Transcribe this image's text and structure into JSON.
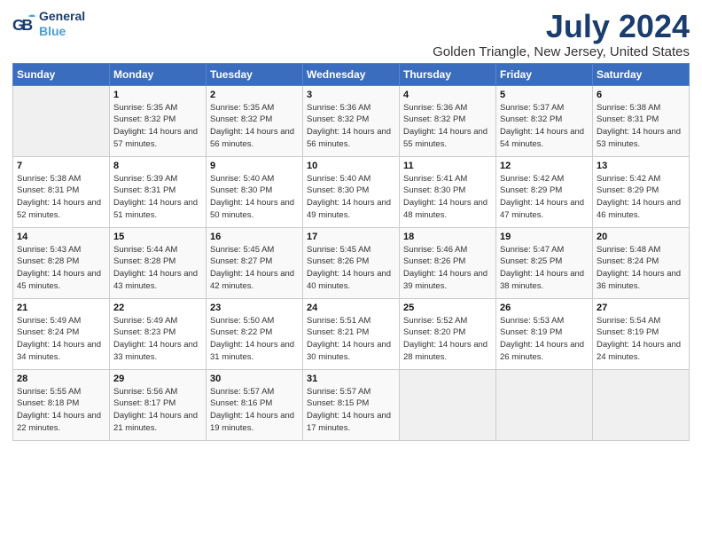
{
  "header": {
    "logo_general": "General",
    "logo_blue": "Blue",
    "month_title": "July 2024",
    "location": "Golden Triangle, New Jersey, United States"
  },
  "weekdays": [
    "Sunday",
    "Monday",
    "Tuesday",
    "Wednesday",
    "Thursday",
    "Friday",
    "Saturday"
  ],
  "weeks": [
    [
      {
        "day": "",
        "empty": true
      },
      {
        "day": "1",
        "sunrise": "5:35 AM",
        "sunset": "8:32 PM",
        "daylight": "14 hours and 57 minutes."
      },
      {
        "day": "2",
        "sunrise": "5:35 AM",
        "sunset": "8:32 PM",
        "daylight": "14 hours and 56 minutes."
      },
      {
        "day": "3",
        "sunrise": "5:36 AM",
        "sunset": "8:32 PM",
        "daylight": "14 hours and 56 minutes."
      },
      {
        "day": "4",
        "sunrise": "5:36 AM",
        "sunset": "8:32 PM",
        "daylight": "14 hours and 55 minutes."
      },
      {
        "day": "5",
        "sunrise": "5:37 AM",
        "sunset": "8:32 PM",
        "daylight": "14 hours and 54 minutes."
      },
      {
        "day": "6",
        "sunrise": "5:38 AM",
        "sunset": "8:31 PM",
        "daylight": "14 hours and 53 minutes."
      }
    ],
    [
      {
        "day": "7",
        "sunrise": "5:38 AM",
        "sunset": "8:31 PM",
        "daylight": "14 hours and 52 minutes."
      },
      {
        "day": "8",
        "sunrise": "5:39 AM",
        "sunset": "8:31 PM",
        "daylight": "14 hours and 51 minutes."
      },
      {
        "day": "9",
        "sunrise": "5:40 AM",
        "sunset": "8:30 PM",
        "daylight": "14 hours and 50 minutes."
      },
      {
        "day": "10",
        "sunrise": "5:40 AM",
        "sunset": "8:30 PM",
        "daylight": "14 hours and 49 minutes."
      },
      {
        "day": "11",
        "sunrise": "5:41 AM",
        "sunset": "8:30 PM",
        "daylight": "14 hours and 48 minutes."
      },
      {
        "day": "12",
        "sunrise": "5:42 AM",
        "sunset": "8:29 PM",
        "daylight": "14 hours and 47 minutes."
      },
      {
        "day": "13",
        "sunrise": "5:42 AM",
        "sunset": "8:29 PM",
        "daylight": "14 hours and 46 minutes."
      }
    ],
    [
      {
        "day": "14",
        "sunrise": "5:43 AM",
        "sunset": "8:28 PM",
        "daylight": "14 hours and 45 minutes."
      },
      {
        "day": "15",
        "sunrise": "5:44 AM",
        "sunset": "8:28 PM",
        "daylight": "14 hours and 43 minutes."
      },
      {
        "day": "16",
        "sunrise": "5:45 AM",
        "sunset": "8:27 PM",
        "daylight": "14 hours and 42 minutes."
      },
      {
        "day": "17",
        "sunrise": "5:45 AM",
        "sunset": "8:26 PM",
        "daylight": "14 hours and 40 minutes."
      },
      {
        "day": "18",
        "sunrise": "5:46 AM",
        "sunset": "8:26 PM",
        "daylight": "14 hours and 39 minutes."
      },
      {
        "day": "19",
        "sunrise": "5:47 AM",
        "sunset": "8:25 PM",
        "daylight": "14 hours and 38 minutes."
      },
      {
        "day": "20",
        "sunrise": "5:48 AM",
        "sunset": "8:24 PM",
        "daylight": "14 hours and 36 minutes."
      }
    ],
    [
      {
        "day": "21",
        "sunrise": "5:49 AM",
        "sunset": "8:24 PM",
        "daylight": "14 hours and 34 minutes."
      },
      {
        "day": "22",
        "sunrise": "5:49 AM",
        "sunset": "8:23 PM",
        "daylight": "14 hours and 33 minutes."
      },
      {
        "day": "23",
        "sunrise": "5:50 AM",
        "sunset": "8:22 PM",
        "daylight": "14 hours and 31 minutes."
      },
      {
        "day": "24",
        "sunrise": "5:51 AM",
        "sunset": "8:21 PM",
        "daylight": "14 hours and 30 minutes."
      },
      {
        "day": "25",
        "sunrise": "5:52 AM",
        "sunset": "8:20 PM",
        "daylight": "14 hours and 28 minutes."
      },
      {
        "day": "26",
        "sunrise": "5:53 AM",
        "sunset": "8:19 PM",
        "daylight": "14 hours and 26 minutes."
      },
      {
        "day": "27",
        "sunrise": "5:54 AM",
        "sunset": "8:19 PM",
        "daylight": "14 hours and 24 minutes."
      }
    ],
    [
      {
        "day": "28",
        "sunrise": "5:55 AM",
        "sunset": "8:18 PM",
        "daylight": "14 hours and 22 minutes."
      },
      {
        "day": "29",
        "sunrise": "5:56 AM",
        "sunset": "8:17 PM",
        "daylight": "14 hours and 21 minutes."
      },
      {
        "day": "30",
        "sunrise": "5:57 AM",
        "sunset": "8:16 PM",
        "daylight": "14 hours and 19 minutes."
      },
      {
        "day": "31",
        "sunrise": "5:57 AM",
        "sunset": "8:15 PM",
        "daylight": "14 hours and 17 minutes."
      },
      {
        "day": "",
        "empty": true
      },
      {
        "day": "",
        "empty": true
      },
      {
        "day": "",
        "empty": true
      }
    ]
  ]
}
